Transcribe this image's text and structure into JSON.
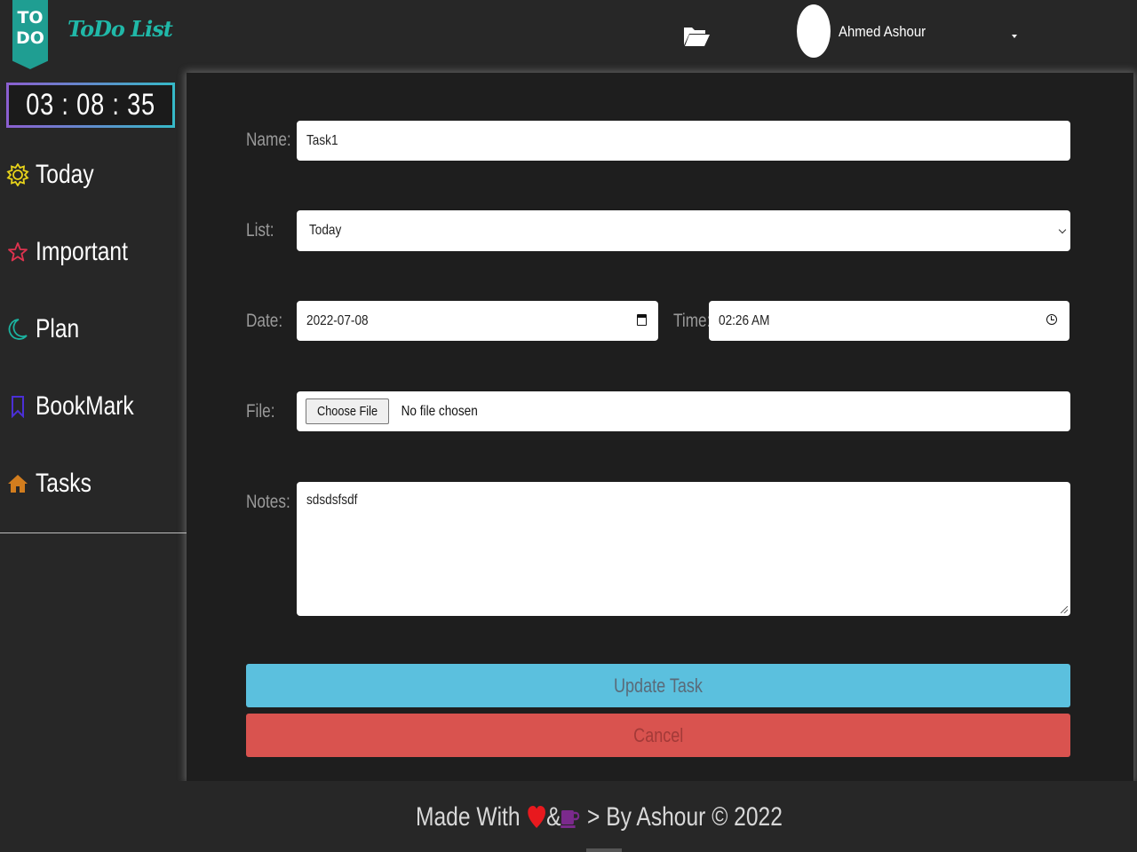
{
  "app": {
    "logo_badge": "TO\nDO",
    "logo_text": "ToDo List"
  },
  "header": {
    "username": "Ahmed Ashour"
  },
  "timer": {
    "display": "03 : 08 : 35"
  },
  "sidebar": {
    "items": [
      {
        "label": "Today",
        "icon": "sun-icon",
        "color": "#e8d31a"
      },
      {
        "label": "Important",
        "icon": "star-icon",
        "color": "#e0334f"
      },
      {
        "label": "Plan",
        "icon": "moon-icon",
        "color": "#1bb3a0"
      },
      {
        "label": "BookMark",
        "icon": "bookmark-icon",
        "color": "#4b2fd6"
      },
      {
        "label": "Tasks",
        "icon": "home-icon",
        "color": "#d27d1e"
      }
    ]
  },
  "form": {
    "name_label": "Name:",
    "name_value": "Task1",
    "list_label": "List:",
    "list_value": "Today",
    "date_label": "Date:",
    "date_value": "2022-07-08",
    "time_label": "Time:",
    "time_value": "02:26 AM",
    "file_label": "File:",
    "file_button": "Choose File",
    "file_status": "No file chosen",
    "notes_label": "Notes:",
    "notes_value": "sdsdsfsdf",
    "update_button": "Update Task",
    "cancel_button": "Cancel"
  },
  "footer": {
    "made_with": "Made With",
    "amp": "&",
    "by": "> By Ashour © 2022"
  },
  "colors": {
    "update": "#5bc0de",
    "cancel": "#d9534f",
    "accent": "#20b8a8"
  }
}
